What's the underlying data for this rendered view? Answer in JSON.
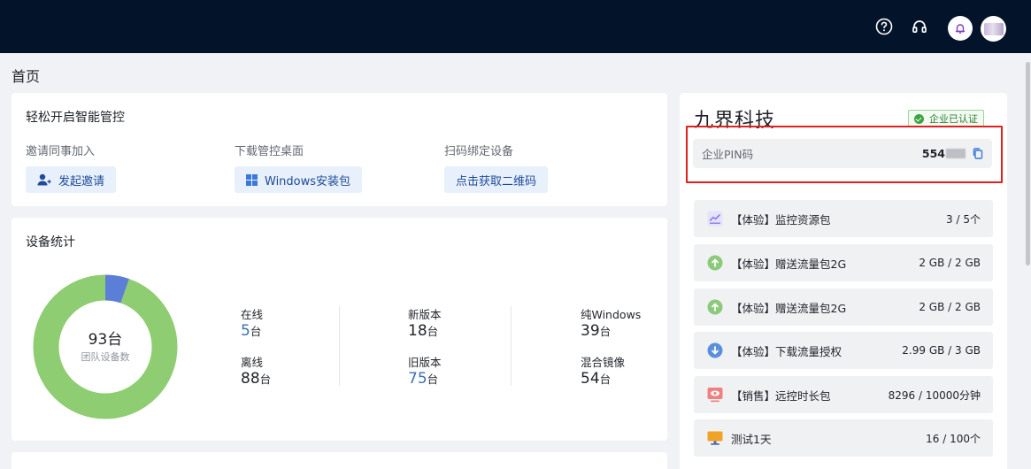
{
  "header": {
    "icons": [
      "help-icon",
      "headset-icon",
      "bell-icon",
      "avatar"
    ]
  },
  "page": {
    "title": "首页"
  },
  "quick_setup": {
    "title": "轻松开启智能管控",
    "actions": [
      {
        "label": "邀请同事加入",
        "button": "发起邀请",
        "icon": "user-add-icon"
      },
      {
        "label": "下载管控桌面",
        "button": "Windows安装包",
        "icon": "windows-icon"
      },
      {
        "label": "扫码绑定设备",
        "button": "点击获取二维码",
        "icon": ""
      }
    ]
  },
  "device_stats": {
    "title": "设备统计",
    "total_value": "93台",
    "total_label": "团队设备数",
    "online_label": "在线",
    "online_value": "5",
    "online_unit": "台",
    "offline_label": "离线",
    "offline_value": "88",
    "offline_unit": "台",
    "new_label": "新版本",
    "new_value": "18",
    "new_unit": "台",
    "old_label": "旧版本",
    "old_value": "75",
    "old_unit": "台",
    "pure_label": "纯Windows",
    "pure_value": "39",
    "pure_unit": "台",
    "mixed_label": "混合镜像",
    "mixed_value": "54",
    "mixed_unit": "台"
  },
  "donut": {
    "segments": [
      {
        "name": "在线",
        "value": 5,
        "color": "#5b7fd6"
      },
      {
        "name": "离线",
        "value": 88,
        "color": "#8fcd72"
      }
    ]
  },
  "company": {
    "name": "九界科技",
    "verified_label": "企业已认证",
    "pin_label": "企业PIN码",
    "pin_value": "554"
  },
  "resources": [
    {
      "name": "【体验】监控资源包",
      "amount": "3 / 5个",
      "icon": "monitor-chart-icon",
      "color": "#8c7ee8"
    },
    {
      "name": "【体验】赠送流量包2G",
      "amount": "2 GB / 2 GB",
      "icon": "upload-cloud-icon",
      "color": "#8cc97a"
    },
    {
      "name": "【体验】赠送流量包2G",
      "amount": "2 GB / 2 GB",
      "icon": "upload-cloud-icon",
      "color": "#8cc97a"
    },
    {
      "name": "【体验】下载流量授权",
      "amount": "2.99 GB / 3 GB",
      "icon": "download-cloud-icon",
      "color": "#5b8fde"
    },
    {
      "name": "【销售】远控时长包",
      "amount": "8296 / 10000分钟",
      "icon": "eye-screen-icon",
      "color": "#f07f7f"
    },
    {
      "name": "测试1天",
      "amount": "16 / 100个",
      "icon": "desktop-icon",
      "color": "#f0a327"
    }
  ]
}
